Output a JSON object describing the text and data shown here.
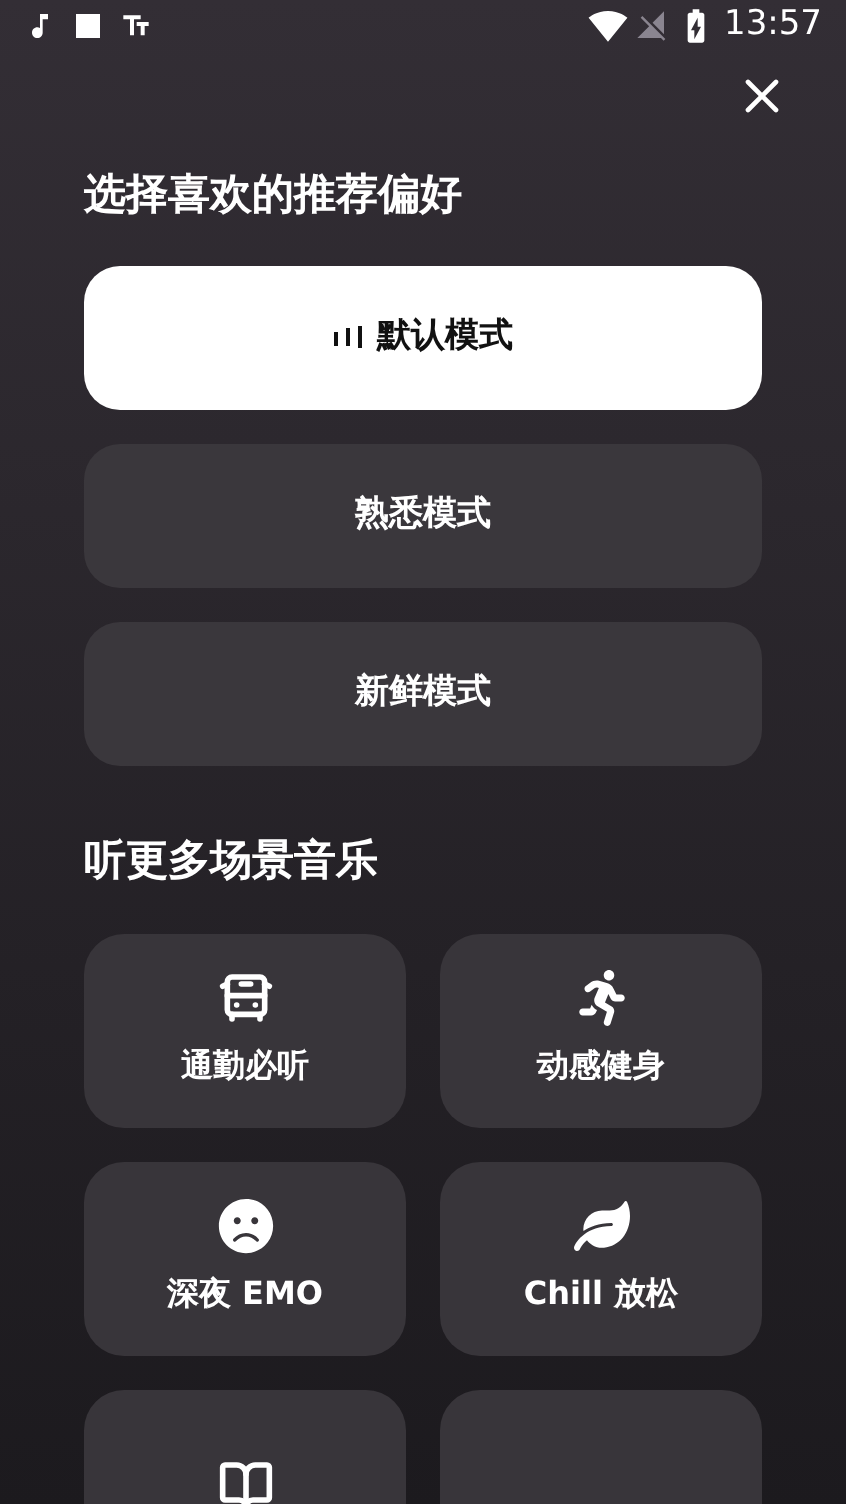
{
  "status_bar": {
    "time": "13:57"
  },
  "preferences": {
    "title": "选择喜欢的推荐偏好",
    "modes": [
      {
        "label": "默认模式",
        "selected": true
      },
      {
        "label": "熟悉模式",
        "selected": false
      },
      {
        "label": "新鲜模式",
        "selected": false
      }
    ]
  },
  "scenes": {
    "title": "听更多场景音乐",
    "items": [
      {
        "kind": "bus",
        "label": "通勤必听"
      },
      {
        "kind": "run",
        "label": "动感健身"
      },
      {
        "kind": "sad",
        "label": "深夜 EMO"
      },
      {
        "kind": "leaf",
        "label": "Chill 放松"
      },
      {
        "kind": "book"
      },
      {
        "kind": "plain"
      }
    ]
  }
}
